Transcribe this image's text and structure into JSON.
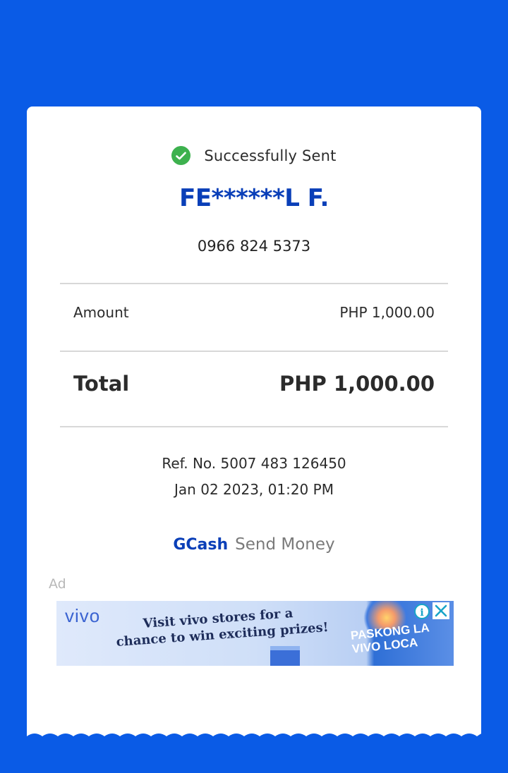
{
  "status": {
    "text": "Successfully Sent",
    "icon": "check-circle-icon",
    "color": "#3db14e"
  },
  "recipient": {
    "name": "FE******L F.",
    "number": "0966 824 5373"
  },
  "amount": {
    "label": "Amount",
    "value": "PHP 1,000.00"
  },
  "total": {
    "label": "Total",
    "value": "PHP 1,000.00"
  },
  "reference": {
    "ref_no": "Ref. No. 5007 483 126450",
    "datetime": "Jan 02 2023, 01:20 PM"
  },
  "brand": {
    "name": "GCash",
    "service": "Send Money",
    "color": "#0a3fb8"
  },
  "ad": {
    "label": "Ad",
    "brand": "vivo",
    "line1": "Visit vivo stores for a",
    "line2": "chance to win exciting prizes!",
    "promo": "PASKONG LA VIVO LOCA",
    "info_icon": "info-icon",
    "close_icon": "close-icon"
  },
  "colors": {
    "background": "#0a5be6",
    "card": "#ffffff"
  }
}
